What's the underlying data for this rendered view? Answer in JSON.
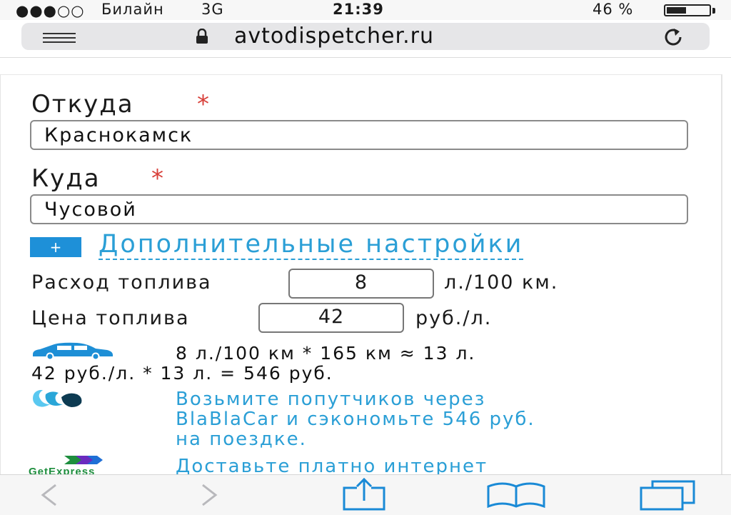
{
  "status_bar": {
    "signal": "●●●○○",
    "carrier": "Билайн",
    "network": "3G",
    "time": "21:39",
    "battery": "46 %",
    "battery_level": 0.46
  },
  "address_bar": {
    "url": "avtodispetcher.ru",
    "menu_icon": "menu-icon",
    "lock_icon": "lock-icon",
    "reload_icon": "reload-icon"
  },
  "form": {
    "from_label": "Откуда",
    "from_value": "Краснокамск",
    "to_label": "Куда",
    "to_value": "Чусовой",
    "required_mark": "*",
    "advanced_plus": "+",
    "advanced_link": "Дополнительные настройки"
  },
  "fuel": {
    "consumption_label": "Расход топлива",
    "consumption_value": "8",
    "consumption_unit": "л./100 км.",
    "price_label": "Цена топлива",
    "price_value": "42",
    "price_unit": "руб./л."
  },
  "calc": {
    "line1": "8 л./100 км * 165 км ≈ 13 л.",
    "line2": "42 руб./л. * 13 л. = 546 руб."
  },
  "promo": {
    "blablacar_line1": "Возьмите попутчиков через",
    "blablacar_line2": "BlaBlaCar и сэкономьте 546 руб.",
    "blablacar_line3": "на поездке.",
    "getexpress_logo_text": "GetExpress",
    "getexpress_line1": "Доставьте платно интернет"
  },
  "colors": {
    "link": "#2b9fd6",
    "required": "#d8403a",
    "plus_button": "#1e90d8"
  },
  "toolbar": {
    "icons": [
      "back-icon",
      "forward-icon",
      "share-icon",
      "bookmarks-icon",
      "tabs-icon"
    ]
  }
}
